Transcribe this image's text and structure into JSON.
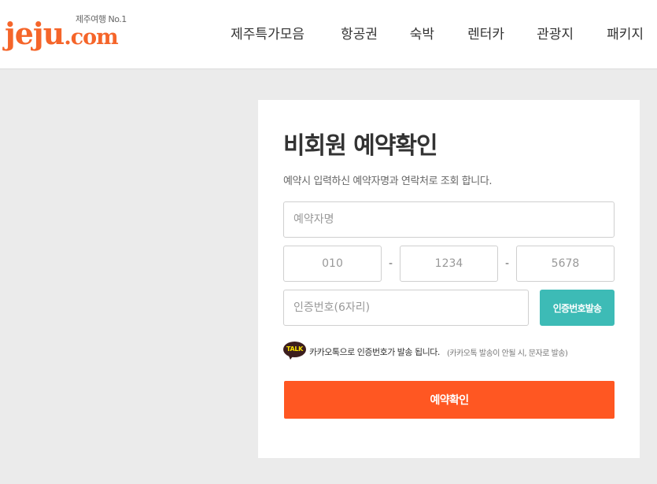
{
  "header": {
    "logo": {
      "main": "jeju",
      "dot_com": ".com",
      "tagline": "제주여행 No.1"
    },
    "nav": [
      {
        "label": "제주특가모음"
      },
      {
        "label": "항공권"
      },
      {
        "label": "숙박"
      },
      {
        "label": "렌터카"
      },
      {
        "label": "관광지"
      },
      {
        "label": "패키지"
      }
    ]
  },
  "form": {
    "title": "비회원 예약확인",
    "subtitle": "예약시 입력하신 예약자명과 연락처로 조회 합니다.",
    "name_placeholder": "예약자명",
    "phone": {
      "part1_placeholder": "010",
      "part2_placeholder": "1234",
      "part3_placeholder": "5678",
      "separator": "-"
    },
    "code_placeholder": "인증번호(6자리)",
    "send_button_label": "인증번호발송",
    "kakao": {
      "icon_label": "TALK",
      "message": "카카오톡으로 인증번호가 발송 됩니다.",
      "note": "(카카오톡 발송이 안될 시, 문자로 발송)"
    },
    "confirm_button_label": "예약확인"
  },
  "colors": {
    "brand_orange": "#f5652a",
    "confirm_button": "#ff5722",
    "send_button": "#3dbbb6",
    "kakao_brown": "#3c1e1e",
    "kakao_yellow": "#f9e000",
    "page_bg": "#ebebeb"
  }
}
